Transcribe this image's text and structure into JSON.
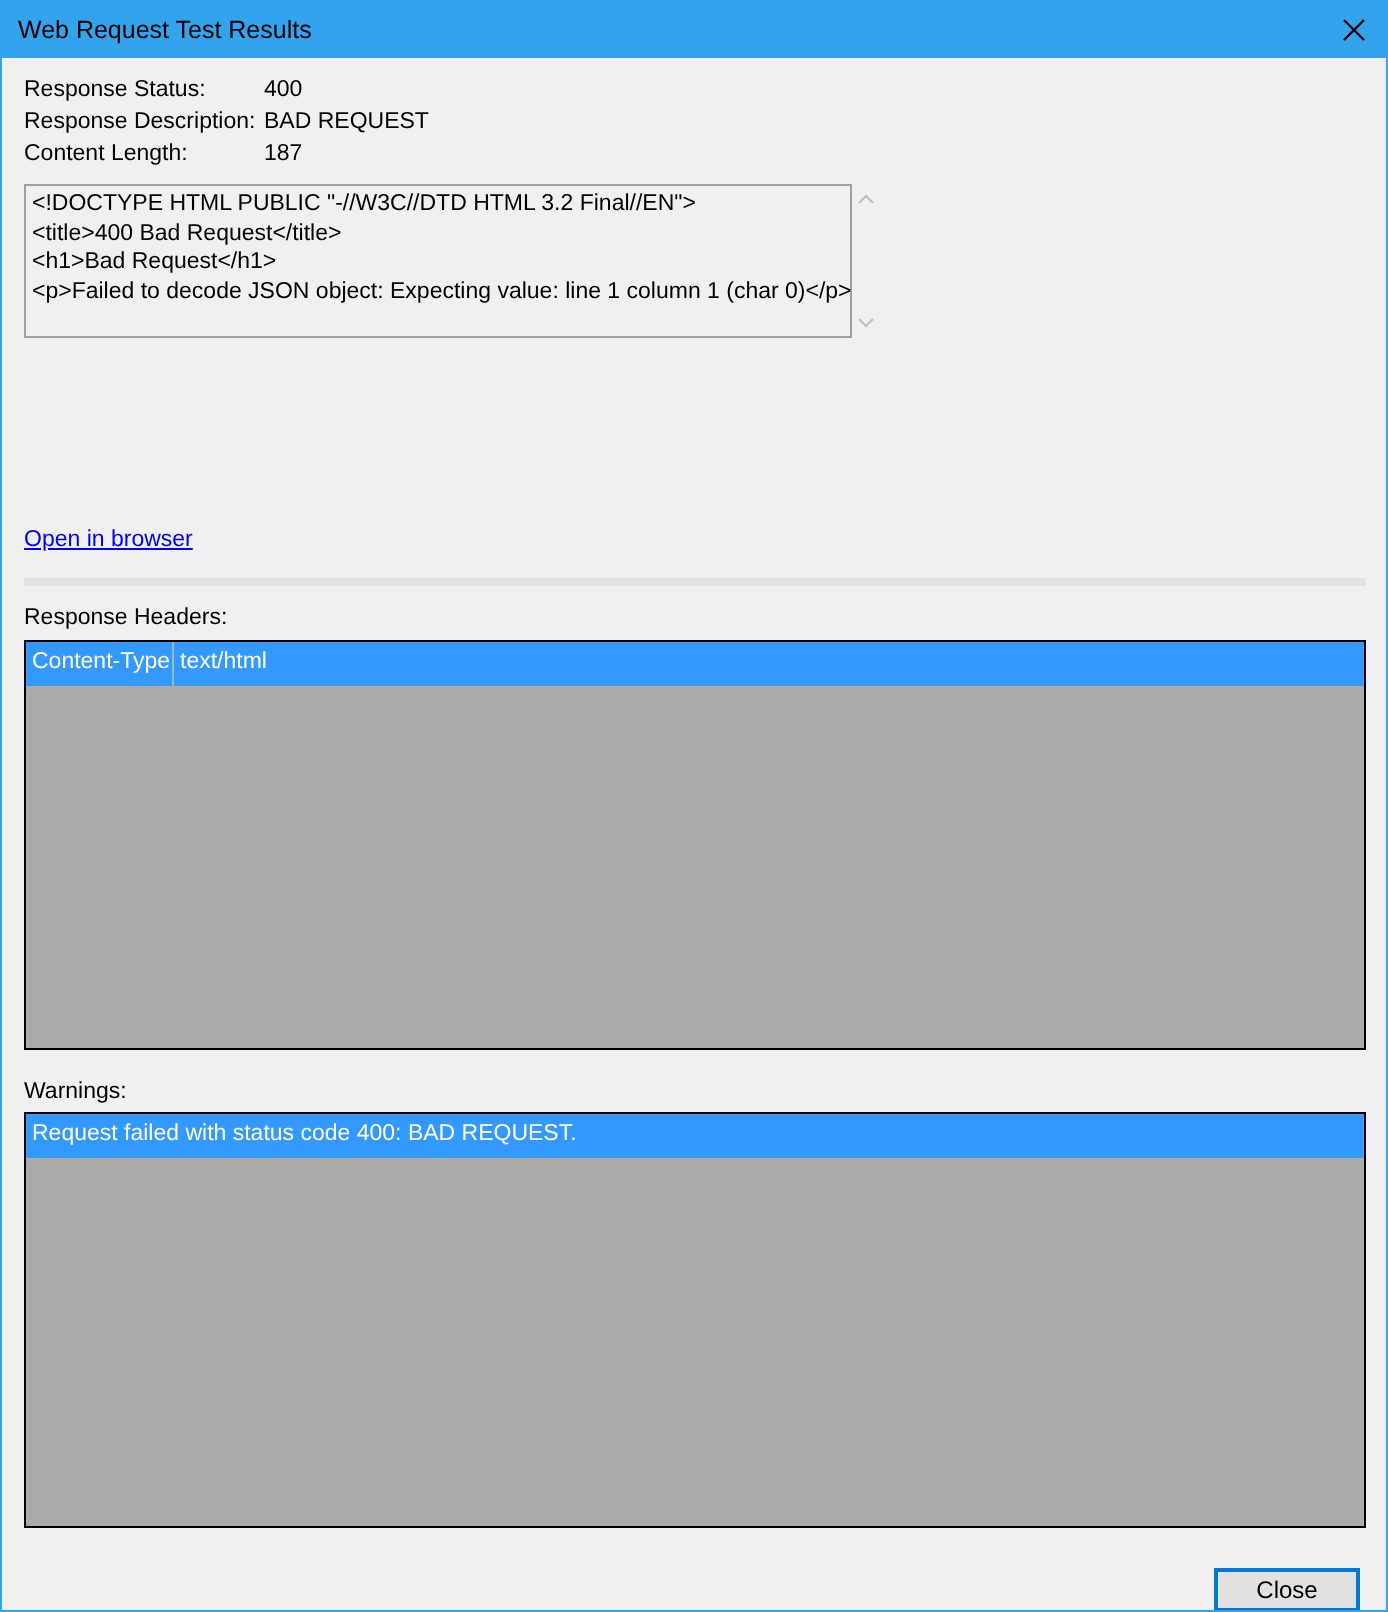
{
  "window": {
    "title": "Web Request Test Results"
  },
  "fields": [
    {
      "label": "Response Status:",
      "value": "400"
    },
    {
      "label": "Response Description:",
      "value": "BAD REQUEST"
    },
    {
      "label": "Content Length:",
      "value": "187"
    }
  ],
  "body_lines": [
    "<!DOCTYPE HTML PUBLIC \"-//W3C//DTD HTML 3.2 Final//EN\">",
    "<title>400 Bad Request</title>",
    "<h1>Bad Request</h1>",
    "<p>Failed to decode JSON object: Expecting value: line 1 column 1 (char 0)</p>"
  ],
  "link": "Open in browser",
  "headers": {
    "label": "Response Headers:",
    "rows": [
      {
        "name": "Content-Type",
        "value": "text/html",
        "selected": true
      }
    ]
  },
  "warnings": {
    "label": "Warnings:",
    "rows": [
      {
        "text": "Request failed with status code 400: BAD REQUEST.",
        "selected": true
      }
    ]
  },
  "buttons": [
    "Close"
  ]
}
